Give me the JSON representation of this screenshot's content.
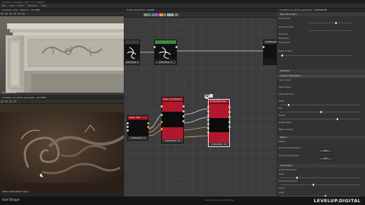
{
  "window": {
    "title": "Substance Designer 2017.1.0 - Untitled"
  },
  "menu": [
    "File",
    "Edit",
    "Tools",
    "Windows",
    "Help"
  ],
  "viewport3d": {
    "title": "Archway_Lintel - Material - 3D VIEW",
    "menu": [
      "Scene",
      "Camera",
      "Environment",
      "Materials",
      "Lights",
      "Display",
      "Renderer"
    ],
    "footer": "Lit Sphere Fine"
  },
  "viewport2d": {
    "title": "Sculpted_car_spline_generator - 2D VIEW",
    "footer": "2048 x 2048 (RGBA8, 16bpc)"
  },
  "graph": {
    "title": "Sculpt_Ornament - GRAPH",
    "nodes": {
      "top_left": {
        "size": "2048x2048 - 8"
      },
      "top_mid": {
        "size": "2048x2048 - 8"
      },
      "top_right": {
        "title": "Transformation",
        "size": ""
      },
      "bl": {
        "title": "Bevel - 8x8",
        "size": "2048x2048 - 8"
      },
      "bm": {
        "title": "Splat - Pro (Splat-V)",
        "size": "2048x2048 - 16"
      },
      "br": {
        "title": "Sculpt Spline Gen",
        "size": "2048x2048 - 16"
      }
    }
  },
  "properties": {
    "title": "Sculpted_car_spline_generator - PROPERTIES",
    "rows": [
      {
        "label": "Base Parameters"
      },
      {
        "label": "Output Size"
      },
      {
        "label": "Output Format"
      },
      {
        "label": "Pixel Size"
      },
      {
        "label": "Pixel Ratio"
      },
      {
        "label": "Tiling Mode"
      },
      {
        "label": "Random Seed"
      }
    ],
    "sections": {
      "attributes": "Attributes",
      "instance": "Instance Parameters",
      "pattern": "Pattern",
      "coordinates": "Coordinates"
    },
    "instance_rows": [
      "Spline Input",
      "Spline Mode",
      "Shape Blending",
      "Width",
      "Roll",
      "Height",
      "Depth Offset",
      "Pattern Height"
    ],
    "pattern_rows": [
      "Pattern",
      "Override Scale Pattern",
      "Override Cap Pattern"
    ],
    "coordinate_rows": [
      "Coordinates Mode",
      "Scale",
      "Amplitude Amount",
      "Invert",
      "Angle",
      "Position Offset"
    ],
    "buttons": {
      "edit1": "Edit",
      "edit2": "Edit"
    }
  },
  "status": {
    "left": "Half Shape",
    "mid": "Substance Engine: GPU Engine",
    "brand": "LEVELUP.DIGITAL"
  },
  "colors": {
    "accent_red": "#b2182b",
    "accent_green": "#3b8a3b",
    "node_bg": "#1b1b1b",
    "wire": "#d8d8d8",
    "wire_orange": "#e8a23a"
  }
}
